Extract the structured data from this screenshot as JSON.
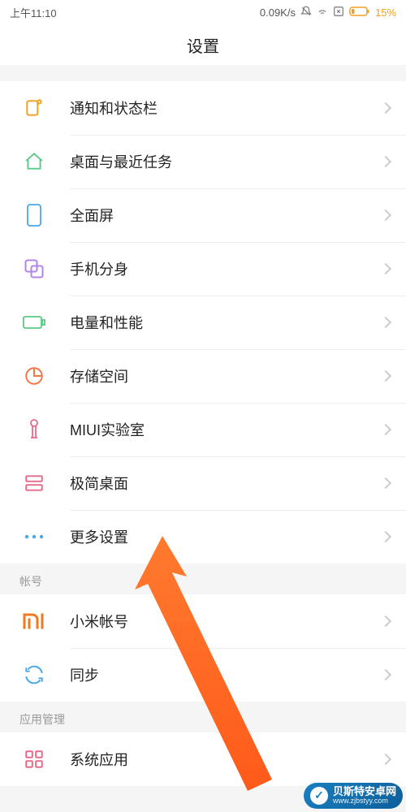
{
  "status_bar": {
    "time": "上午11:10",
    "net_speed": "0.09K/s",
    "battery_pct": "15%"
  },
  "header": {
    "title": "设置"
  },
  "groups": [
    {
      "header": null,
      "items": [
        {
          "id": "notification",
          "label": "通知和状态栏"
        },
        {
          "id": "home-recents",
          "label": "桌面与最近任务"
        },
        {
          "id": "fullscreen",
          "label": "全面屏"
        },
        {
          "id": "second-space",
          "label": "手机分身"
        },
        {
          "id": "battery-perf",
          "label": "电量和性能"
        },
        {
          "id": "storage",
          "label": "存储空间"
        },
        {
          "id": "miui-lab",
          "label": "MIUI实验室"
        },
        {
          "id": "lite-mode",
          "label": "极简桌面"
        },
        {
          "id": "more-settings",
          "label": "更多设置"
        }
      ]
    },
    {
      "header": "帐号",
      "items": [
        {
          "id": "mi-account",
          "label": "小米帐号"
        },
        {
          "id": "sync",
          "label": "同步"
        }
      ]
    },
    {
      "header": "应用管理",
      "items": [
        {
          "id": "system-apps",
          "label": "系统应用"
        }
      ]
    }
  ],
  "watermark": {
    "name": "贝斯特安卓网",
    "url": "www.zjbstyy.com"
  }
}
